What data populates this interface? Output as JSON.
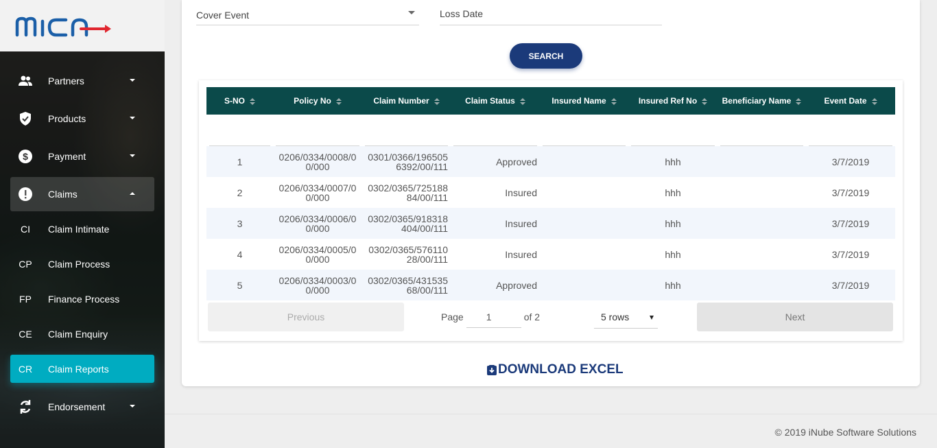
{
  "app": {
    "logo_text": "mica"
  },
  "sidebar": {
    "items": [
      {
        "label": "Partners",
        "icon": "people-icon"
      },
      {
        "label": "Products",
        "icon": "shield-check-icon"
      },
      {
        "label": "Payment",
        "icon": "dollar-circle-icon"
      },
      {
        "label": "Claims",
        "icon": "alert-circle-icon"
      }
    ],
    "sub_items": [
      {
        "abbr": "CI",
        "label": "Claim Intimate"
      },
      {
        "abbr": "CP",
        "label": "Claim Process"
      },
      {
        "abbr": "FP",
        "label": "Finance Process"
      },
      {
        "abbr": "CE",
        "label": "Claim Enquiry"
      },
      {
        "abbr": "CR",
        "label": "Claim Reports"
      }
    ],
    "endorsement": {
      "label": "Endorsement",
      "icon": "sync-icon"
    }
  },
  "form": {
    "cover_event_label": "Cover Event",
    "loss_date_label": "Loss Date",
    "search_label": "SEARCH"
  },
  "table": {
    "headers": [
      "S-NO",
      "Policy No",
      "Claim Number",
      "Claim Status",
      "Insured Name",
      "Insured Ref No",
      "Beneficiary Name",
      "Event Date"
    ],
    "rows": [
      {
        "sno": "1",
        "policy_no": "0206/0334/0008/00/000",
        "claim_number": "0301/0366/1965056392/00/111",
        "status": "Approved",
        "insured_name": "",
        "insured_ref": "hhh",
        "beneficiary": "",
        "event_date": "3/7/2019"
      },
      {
        "sno": "2",
        "policy_no": "0206/0334/0007/00/000",
        "claim_number": "0302/0365/72518884/00/111",
        "status": "Insured",
        "insured_name": "",
        "insured_ref": "hhh",
        "beneficiary": "",
        "event_date": "3/7/2019"
      },
      {
        "sno": "3",
        "policy_no": "0206/0334/0006/00/000",
        "claim_number": "0302/0365/918318404/00/111",
        "status": "Insured",
        "insured_name": "",
        "insured_ref": "hhh",
        "beneficiary": "",
        "event_date": "3/7/2019"
      },
      {
        "sno": "4",
        "policy_no": "0206/0334/0005/00/000",
        "claim_number": "0302/0365/57611028/00/111",
        "status": "Insured",
        "insured_name": "",
        "insured_ref": "hhh",
        "beneficiary": "",
        "event_date": "3/7/2019"
      },
      {
        "sno": "5",
        "policy_no": "0206/0334/0003/00/000",
        "claim_number": "0302/0365/43153568/00/111",
        "status": "Approved",
        "insured_name": "",
        "insured_ref": "hhh",
        "beneficiary": "",
        "event_date": "3/7/2019"
      }
    ]
  },
  "pagination": {
    "previous_label": "Previous",
    "page_label": "Page",
    "page_value": "1",
    "of_label": "of 2",
    "rows_label": "5 rows",
    "next_label": "Next"
  },
  "download_label": "DOWNLOAD EXCEL",
  "footer": {
    "copyright": "© 2019 iNube Software Solutions"
  },
  "colors": {
    "accent": "#00acc1",
    "primary": "#1b3a7a",
    "table_header": "#0b4a4a",
    "logo_red": "#e0262f"
  }
}
